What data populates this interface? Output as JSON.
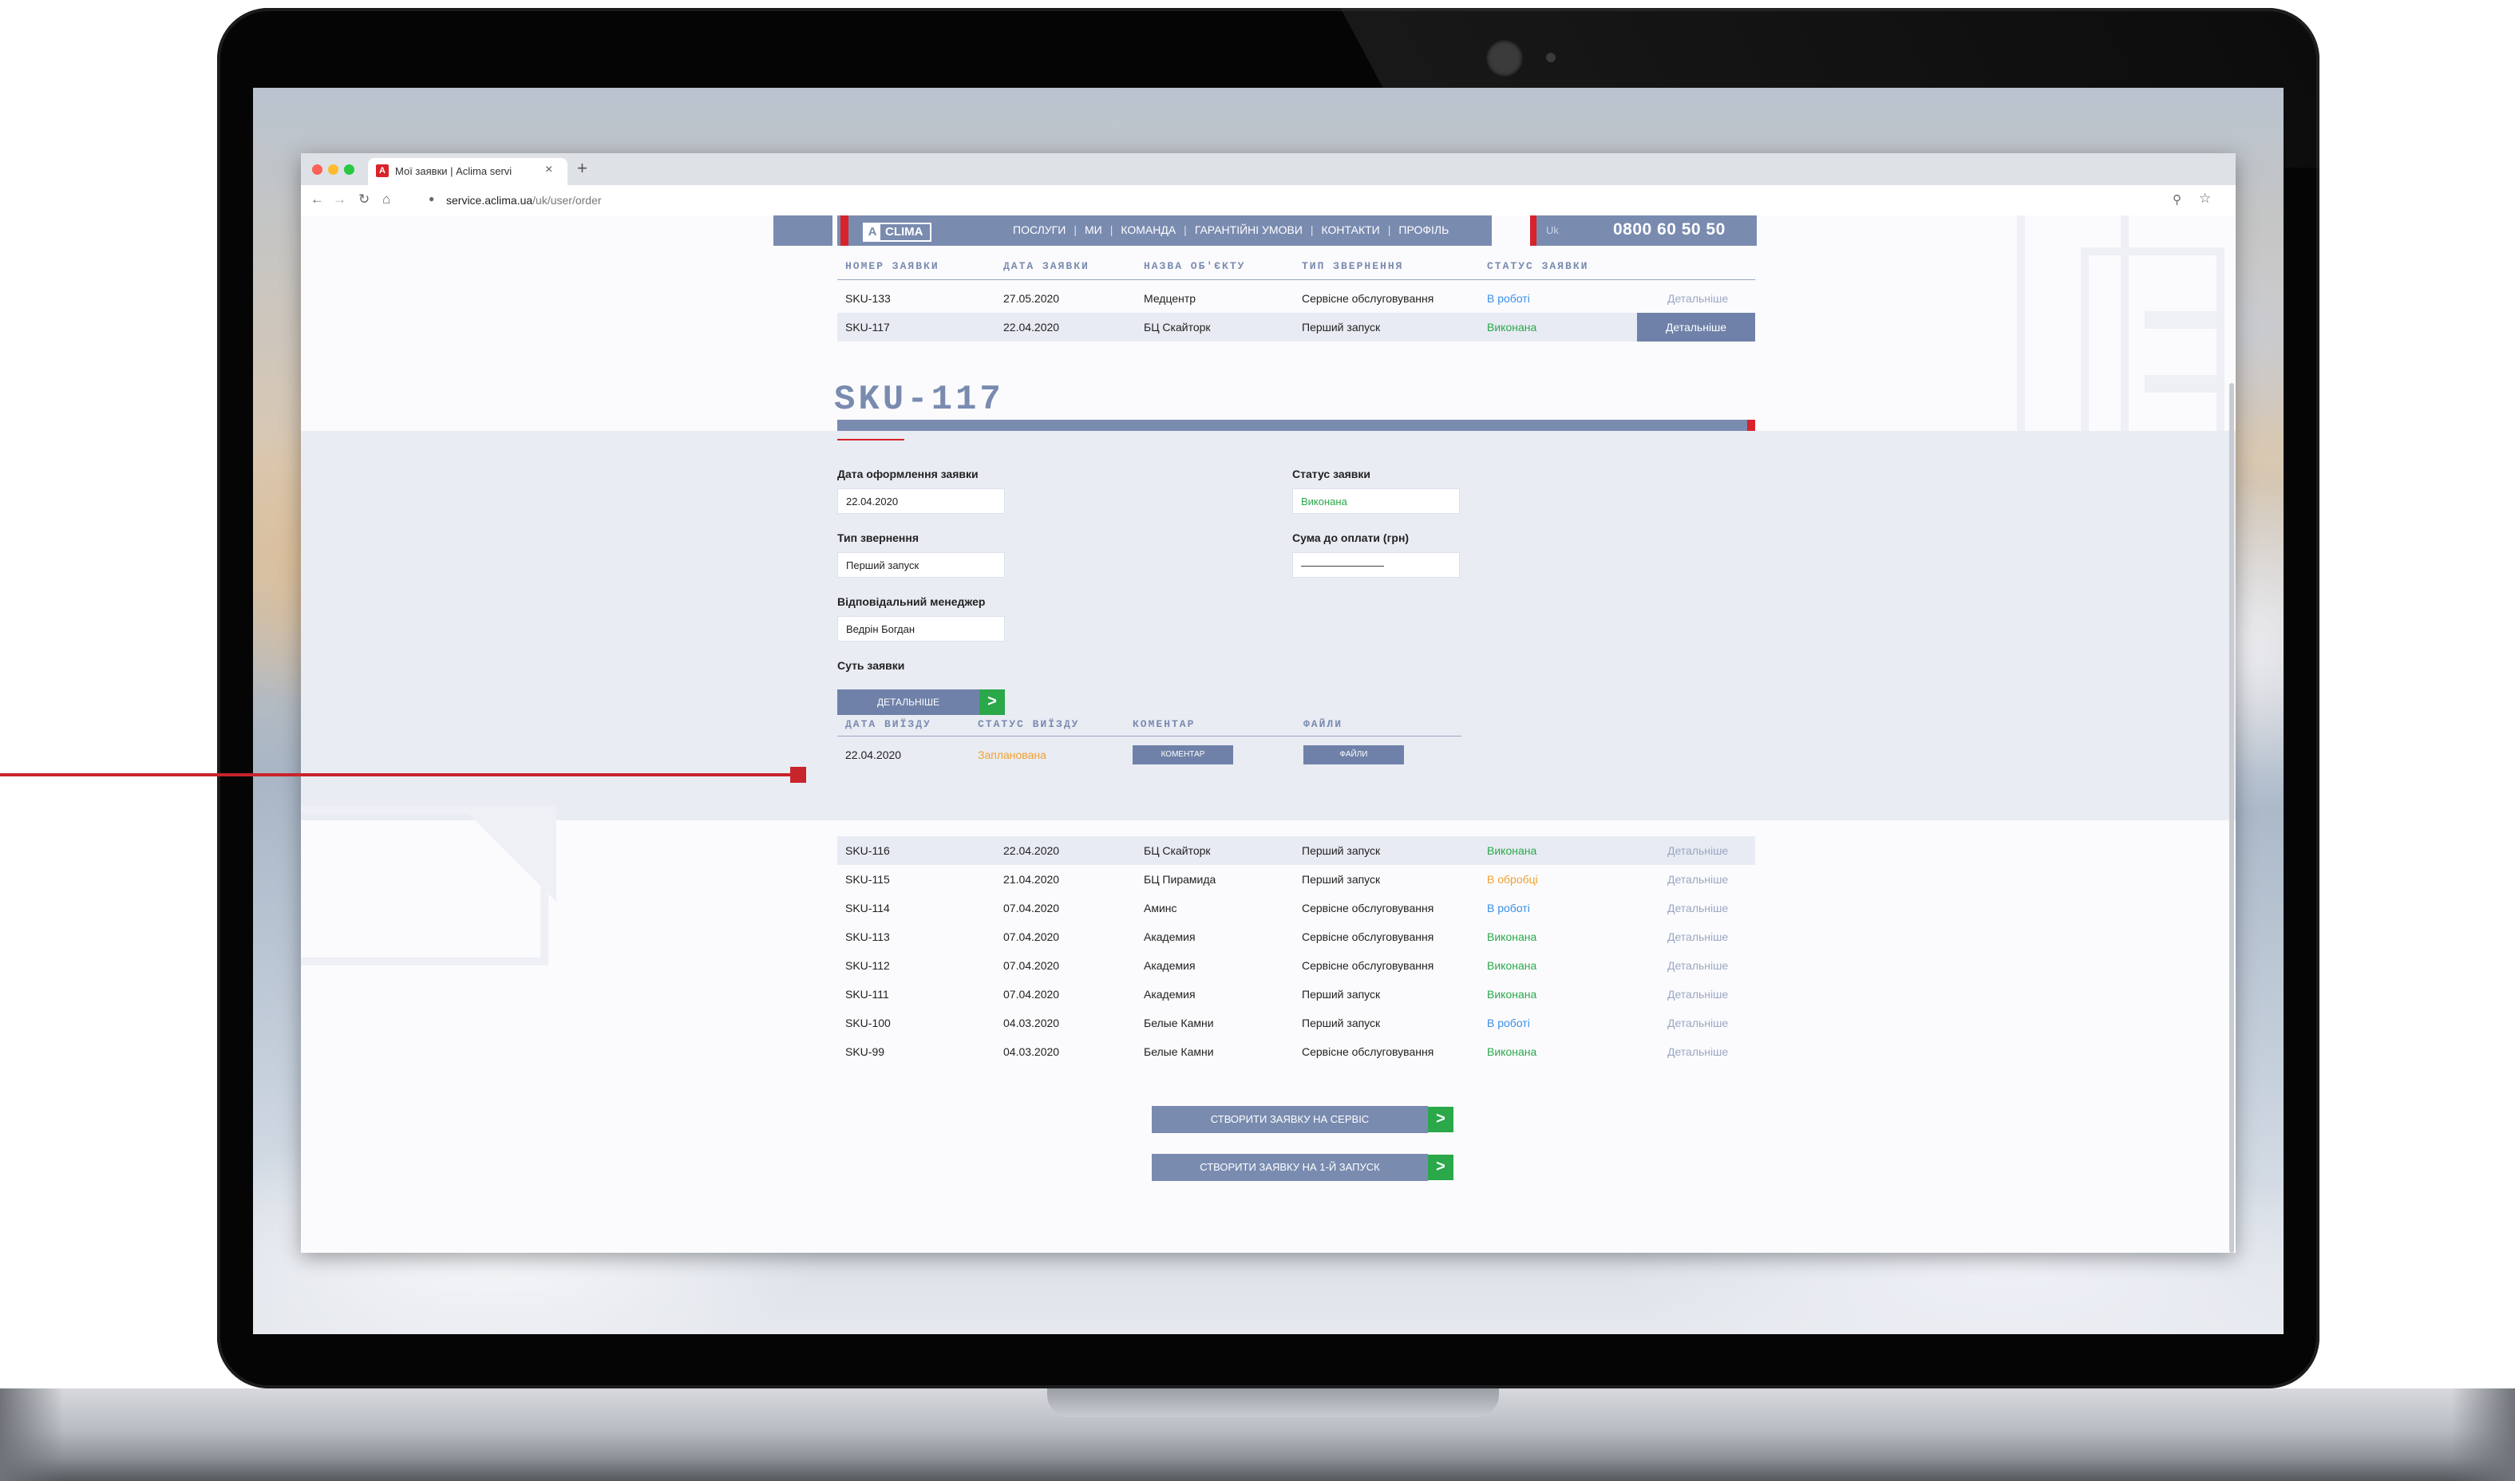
{
  "browser": {
    "tab_title": "Мої заявки | Aclima servi",
    "tab_favicon": "A",
    "tab_close": "×",
    "new_tab": "+",
    "url_host": "service.aclima.ua",
    "url_path": "/uk/user/order",
    "icons": [
      "back-arrow-icon",
      "forward-arrow-icon",
      "reload-icon",
      "home-icon",
      "lock-icon",
      "zoom-icon",
      "star-icon"
    ]
  },
  "header": {
    "logo_mark": "A",
    "logo_text": "CLIMA",
    "nav": [
      {
        "label": "ПОСЛУГИ"
      },
      {
        "label": "МИ"
      },
      {
        "label": "КОМАНДА"
      },
      {
        "label": "ГАРАНТІЙНІ УМОВИ"
      },
      {
        "label": "КОНТАКТИ"
      },
      {
        "label": "ПРОФІЛЬ"
      }
    ],
    "separator": "|",
    "lang": "Uk",
    "phone": "0800 60 50 50"
  },
  "orders_table": {
    "columns": [
      "НОМЕР ЗАЯВКИ",
      "ДАТА ЗАЯВКИ",
      "НАЗВА ОБ'ЄКТУ",
      "ТИП ЗВЕРНЕННЯ",
      "СТАТУС ЗАЯВКИ"
    ],
    "details_label": "Детальніше",
    "top_rows": [
      {
        "id": "SKU-133",
        "date": "27.05.2020",
        "object": "Медцентр",
        "type": "Сервісне обслуговування",
        "status": "В роботі"
      },
      {
        "id": "SKU-117",
        "date": "22.04.2020",
        "object": "БЦ Скайторк",
        "type": "Перший запуск",
        "status": "Виконана"
      }
    ],
    "bottom_rows": [
      {
        "id": "SKU-116",
        "date": "22.04.2020",
        "object": "БЦ Скайторк",
        "type": "Перший запуск",
        "status": "Виконана"
      },
      {
        "id": "SKU-115",
        "date": "21.04.2020",
        "object": "БЦ Пирамида",
        "type": "Перший запуск",
        "status": "В обробці"
      },
      {
        "id": "SKU-114",
        "date": "07.04.2020",
        "object": "Аминс",
        "type": "Сервісне обслуговування",
        "status": "В роботі"
      },
      {
        "id": "SKU-113",
        "date": "07.04.2020",
        "object": "Академия",
        "type": "Сервісне обслуговування",
        "status": "Виконана"
      },
      {
        "id": "SKU-112",
        "date": "07.04.2020",
        "object": "Академия",
        "type": "Сервісне обслуговування",
        "status": "Виконана"
      },
      {
        "id": "SKU-111",
        "date": "07.04.2020",
        "object": "Академия",
        "type": "Перший запуск",
        "status": "Виконана"
      },
      {
        "id": "SKU-100",
        "date": "04.03.2020",
        "object": "Белые Камни",
        "type": "Перший запуск",
        "status": "В роботі"
      },
      {
        "id": "SKU-99",
        "date": "04.03.2020",
        "object": "Белые Камни",
        "type": "Сервісне обслуговування",
        "status": "Виконана"
      }
    ]
  },
  "detail": {
    "title": "SKU-117",
    "date_label": "Дата оформлення заявки",
    "date_value": "22.04.2020",
    "type_label": "Тип звернення",
    "type_value": "Перший запуск",
    "manager_label": "Відповідальний менеджер",
    "manager_value": "Ведрін Богдан",
    "essence_label": "Суть заявки",
    "essence_button": "ДЕТАЛЬНІШЕ",
    "status_label": "Статус заявки",
    "status_value": "Виконана",
    "sum_label": "Сума до оплати (грн)",
    "sum_value": "————————",
    "arrow": ">",
    "trips": {
      "columns": [
        "ДАТА ВИЇЗДУ",
        "СТАТУС ВИЇЗДУ",
        "КОМЕНТАР",
        "ФАЙЛИ"
      ],
      "row": {
        "date": "22.04.2020",
        "status": "Запланована",
        "comment_button": "КОМЕНТАР",
        "files_button": "ФАЙЛИ"
      }
    }
  },
  "actions": {
    "create_service": "СТВОРИТИ ЗАЯВКУ НА СЕРВІС",
    "create_first_launch": "СТВОРИТИ ЗАЯВКУ НА 1-Й ЗАПУСК"
  },
  "colors": {
    "brand_blue": "#7a8bb0",
    "brand_red": "#d8232a",
    "status_done": "#2aa84a",
    "status_in_work": "#3a8ee6",
    "status_processing": "#f0a030"
  }
}
